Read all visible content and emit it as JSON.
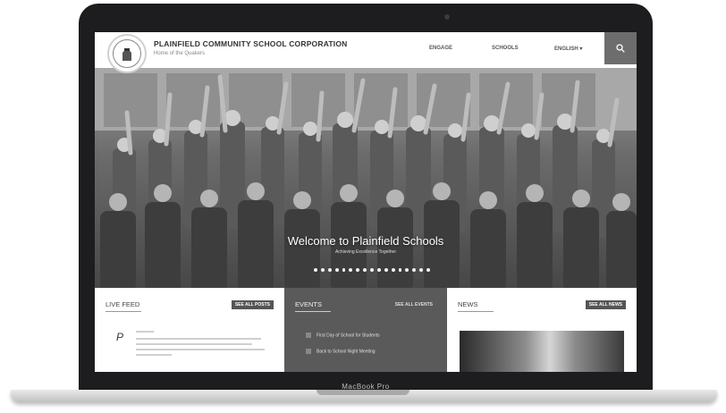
{
  "site": {
    "title": "PLAINFIELD COMMUNITY SCHOOL CORPORATION",
    "subtitle": "Home of the Quakers"
  },
  "nav": [
    "ENGAGE",
    "SCHOOLS",
    "ENGLISH"
  ],
  "hero": {
    "title": "Welcome to Plainfield Schools",
    "subtitle": "Achieving Excellence Together",
    "slide_count": 17
  },
  "panels": {
    "live_feed": {
      "title": "LIVE FEED",
      "button": "SEE ALL POSTS"
    },
    "events": {
      "title": "EVENTS",
      "button": "SEE ALL EVENTS",
      "items": [
        "First Day of School for Students",
        "Back to School Night Meeting"
      ]
    },
    "news": {
      "title": "NEWS",
      "button": "SEE ALL NEWS"
    }
  },
  "device": {
    "label": "MacBook Pro"
  }
}
